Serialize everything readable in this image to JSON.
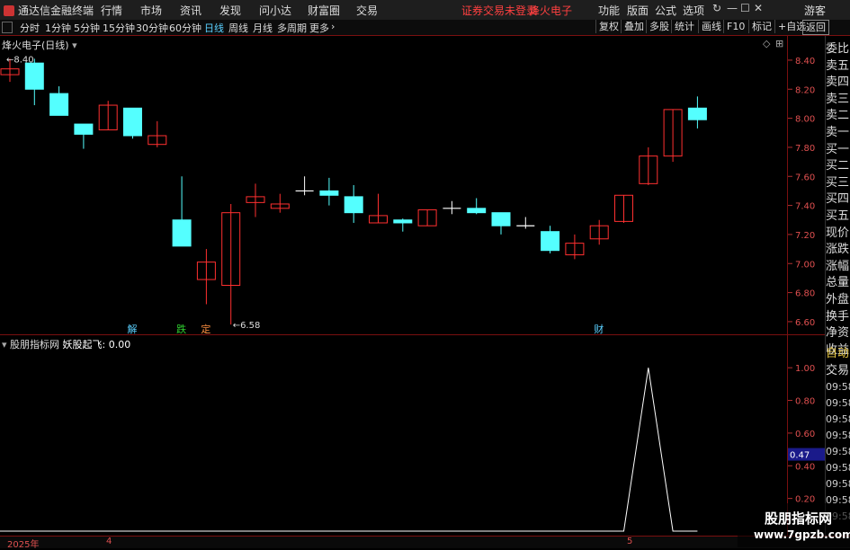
{
  "titlebar": {
    "app_name": "通达信金融终端",
    "menus": [
      "行情",
      "市场",
      "资讯",
      "发现",
      "问小达",
      "财富圈",
      "交易"
    ],
    "status_warning": "证券交易未登录",
    "stock_name": "烽火电子",
    "right_menus": [
      "功能",
      "版面",
      "公式",
      "选项"
    ],
    "user": "游客"
  },
  "toolbar": {
    "periods": [
      "分时",
      "1分钟",
      "5分钟",
      "15分钟",
      "30分钟",
      "60分钟",
      "日线",
      "周线",
      "月线",
      "多周期",
      "更多"
    ],
    "active_period": "日线",
    "right_buttons": [
      "复权",
      "叠加",
      "多股",
      "统计",
      "画线",
      "F10",
      "标记",
      "+自选",
      "返回"
    ]
  },
  "main_chart": {
    "title": "烽火电子(日线)",
    "high_label": "8.40",
    "low_label": "6.58",
    "y_ticks": [
      "8.40",
      "8.20",
      "8.00",
      "7.80",
      "7.60",
      "7.40",
      "7.20",
      "7.00",
      "6.80",
      "6.60"
    ],
    "markers": [
      {
        "text": "解",
        "color": "#5ad0ff",
        "index": 5
      },
      {
        "text": "跌",
        "color": "#30d030",
        "index": 7
      },
      {
        "text": "定",
        "color": "#ff9040",
        "index": 8
      },
      {
        "text": "财",
        "color": "#5ad0ff",
        "index": 24
      }
    ]
  },
  "side_panel": {
    "items": [
      "委比",
      "卖五",
      "卖四",
      "卖三",
      "卖二",
      "卖一",
      "买一",
      "买二",
      "买三",
      "买四",
      "买五",
      "现价",
      "涨跌",
      "涨幅",
      "总量",
      "外盘",
      "换手",
      "净资",
      "收益"
    ],
    "lower_items": [
      "自动",
      "交易"
    ],
    "times": [
      "09:58",
      "09:58",
      "09:58",
      "09:58",
      "09:58",
      "09:58",
      "09:58",
      "09:58",
      "09:58"
    ]
  },
  "indicator": {
    "title_name": "股朋指标网",
    "title_formula": "妖股起飞: 0.00",
    "y_ticks": [
      "1.00",
      "0.80",
      "0.60",
      "0.40",
      "0.20"
    ],
    "cursor_value": "0.47"
  },
  "footer": {
    "labels": [
      "2025年",
      "4",
      "5"
    ]
  },
  "watermark": {
    "line1": "股朋指标网",
    "line2": "www.7gpzb.com"
  },
  "colors": {
    "up": "#ff3030",
    "down": "#54ffff",
    "neutral": "#ffffff",
    "grid_red": "#7a1010"
  },
  "chart_data": {
    "type": "candlestick",
    "title": "烽火电子(日线)",
    "ylim": [
      6.55,
      8.48
    ],
    "candles": [
      {
        "o": 8.3,
        "c": 8.34,
        "h": 8.41,
        "l": 8.25
      },
      {
        "o": 8.38,
        "c": 8.2,
        "h": 8.41,
        "l": 8.09
      },
      {
        "o": 8.17,
        "c": 8.02,
        "h": 8.22,
        "l": 8.02
      },
      {
        "o": 7.96,
        "c": 7.89,
        "h": 7.96,
        "l": 7.79
      },
      {
        "o": 7.92,
        "c": 8.09,
        "h": 8.12,
        "l": 7.92
      },
      {
        "o": 8.07,
        "c": 7.88,
        "h": 8.07,
        "l": 7.86
      },
      {
        "o": 7.82,
        "c": 7.88,
        "h": 7.98,
        "l": 7.8
      },
      {
        "o": 7.3,
        "c": 7.12,
        "h": 7.6,
        "l": 7.12
      },
      {
        "o": 6.89,
        "c": 7.01,
        "h": 7.1,
        "l": 6.72
      },
      {
        "o": 6.85,
        "c": 7.35,
        "h": 7.41,
        "l": 6.58
      },
      {
        "o": 7.42,
        "c": 7.46,
        "h": 7.55,
        "l": 7.32
      },
      {
        "o": 7.38,
        "c": 7.41,
        "h": 7.48,
        "l": 7.35
      },
      {
        "o": 7.5,
        "c": 7.5,
        "h": 7.6,
        "l": 7.47
      },
      {
        "o": 7.5,
        "c": 7.47,
        "h": 7.59,
        "l": 7.4
      },
      {
        "o": 7.46,
        "c": 7.35,
        "h": 7.54,
        "l": 7.28
      },
      {
        "o": 7.28,
        "c": 7.33,
        "h": 7.48,
        "l": 7.28
      },
      {
        "o": 7.3,
        "c": 7.28,
        "h": 7.31,
        "l": 7.22
      },
      {
        "o": 7.26,
        "c": 7.37,
        "h": 7.37,
        "l": 7.26
      },
      {
        "o": 7.38,
        "c": 7.38,
        "h": 7.43,
        "l": 7.34
      },
      {
        "o": 7.38,
        "c": 7.35,
        "h": 7.45,
        "l": 7.34
      },
      {
        "o": 7.35,
        "c": 7.26,
        "h": 7.35,
        "l": 7.2
      },
      {
        "o": 7.26,
        "c": 7.26,
        "h": 7.32,
        "l": 7.24
      },
      {
        "o": 7.22,
        "c": 7.09,
        "h": 7.26,
        "l": 7.07
      },
      {
        "o": 7.06,
        "c": 7.14,
        "h": 7.2,
        "l": 7.03
      },
      {
        "o": 7.17,
        "c": 7.26,
        "h": 7.3,
        "l": 7.13
      },
      {
        "o": 7.29,
        "c": 7.47,
        "h": 7.47,
        "l": 7.28
      },
      {
        "o": 7.55,
        "c": 7.74,
        "h": 7.8,
        "l": 7.54
      },
      {
        "o": 7.74,
        "c": 8.06,
        "h": 8.06,
        "l": 7.7
      },
      {
        "o": 8.07,
        "c": 7.99,
        "h": 8.15,
        "l": 7.93
      }
    ],
    "indicator_series": {
      "name": "妖股起飞",
      "ylim": [
        0,
        1.1
      ],
      "values": [
        0,
        0,
        0,
        0,
        0,
        0,
        0,
        0,
        0,
        0,
        0,
        0,
        0,
        0,
        0,
        0,
        0,
        0,
        0,
        0,
        0,
        0,
        0,
        0,
        0,
        0,
        1,
        0,
        0
      ]
    }
  }
}
